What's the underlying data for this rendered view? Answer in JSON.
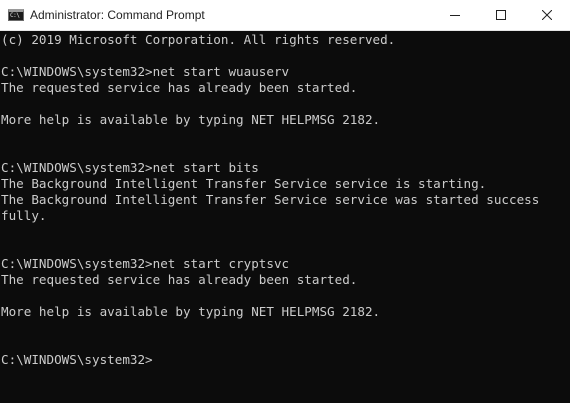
{
  "window": {
    "title": "Administrator: Command Prompt",
    "icon_label": "C:\\",
    "controls": {
      "minimize": "minimize-icon",
      "maximize": "maximize-icon",
      "close": "close-icon"
    }
  },
  "console": {
    "lines": [
      "(c) 2019 Microsoft Corporation. All rights reserved.",
      "",
      "C:\\WINDOWS\\system32>net start wuauserv",
      "The requested service has already been started.",
      "",
      "More help is available by typing NET HELPMSG 2182.",
      "",
      "",
      "C:\\WINDOWS\\system32>net start bits",
      "The Background Intelligent Transfer Service service is starting.",
      "The Background Intelligent Transfer Service service was started success",
      "fully.",
      "",
      "",
      "C:\\WINDOWS\\system32>net start cryptsvc",
      "The requested service has already been started.",
      "",
      "More help is available by typing NET HELPMSG 2182.",
      "",
      "",
      "C:\\WINDOWS\\system32>"
    ]
  },
  "colors": {
    "console_bg": "#0c0c0c",
    "console_fg": "#cccccc",
    "titlebar_bg": "#ffffff"
  }
}
